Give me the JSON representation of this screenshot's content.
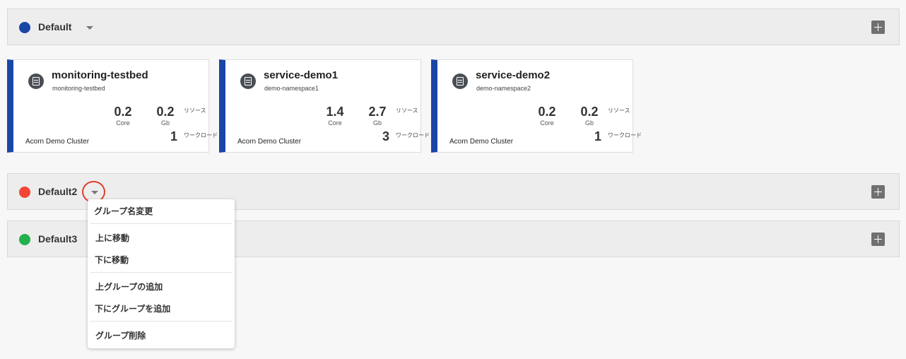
{
  "groups": [
    {
      "name": "Default",
      "color": "#1a47a5"
    },
    {
      "name": "Default2",
      "color": "#f24437"
    },
    {
      "name": "Default3",
      "color": "#22b14c"
    }
  ],
  "cards": [
    {
      "title": "monitoring-testbed",
      "namespace": "monitoring-testbed",
      "core": "0.2",
      "core_unit": "Core",
      "memory": "0.2",
      "memory_unit": "Gb",
      "resource_label": "リソース",
      "workloads": "1",
      "workload_label": "ワークロード",
      "cluster": "Acorn Demo Cluster"
    },
    {
      "title": "service-demo1",
      "namespace": "demo-namespace1",
      "core": "1.4",
      "core_unit": "Core",
      "memory": "2.7",
      "memory_unit": "Gb",
      "resource_label": "リソース",
      "workloads": "3",
      "workload_label": "ワークロード",
      "cluster": "Acorn Demo Cluster"
    },
    {
      "title": "service-demo2",
      "namespace": "demo-namespace2",
      "core": "0.2",
      "core_unit": "Core",
      "memory": "0.2",
      "memory_unit": "Gb",
      "resource_label": "リソース",
      "workloads": "1",
      "workload_label": "ワークロード",
      "cluster": "Acorn Demo Cluster"
    }
  ],
  "menu": {
    "rename": "グループ名変更",
    "move_up": "上に移動",
    "move_down": "下に移動",
    "add_above": "上グループの追加",
    "add_below": "下にグループを追加",
    "delete": "グループ削除"
  },
  "icons": {
    "dropdown": "caret-down-icon",
    "add": "plus-icon",
    "namespace": "namespace-cube-icon"
  }
}
